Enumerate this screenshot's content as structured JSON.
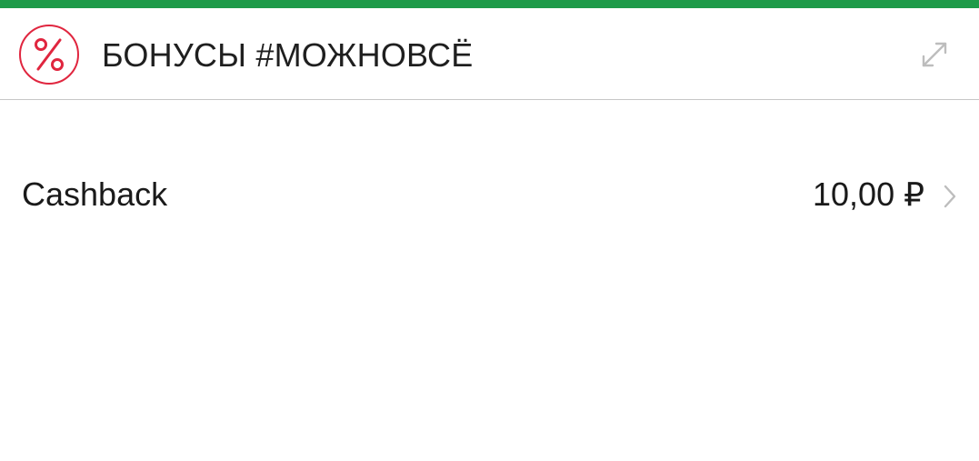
{
  "colors": {
    "accent_bar": "#1e9b49",
    "badge": "#e0263f",
    "text": "#1a1a1a",
    "muted_icon": "#bdbdbd",
    "divider": "#c7c7c7"
  },
  "header": {
    "badge_icon": "percent-icon",
    "title": "БОНУСЫ #МОЖНОВСЁ",
    "expand_icon": "expand-arrows-icon"
  },
  "rows": [
    {
      "label": "Cashback",
      "amount": "10,00 ₽",
      "chevron_icon": "chevron-right-icon"
    }
  ]
}
